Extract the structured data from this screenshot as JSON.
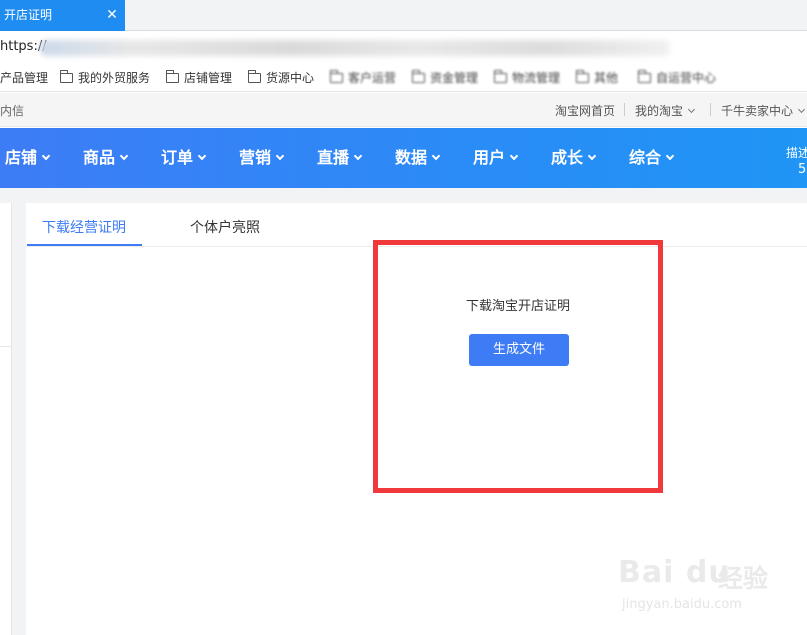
{
  "browser": {
    "tab_title": "开店证明",
    "close_glyph": "✕",
    "url_visible": "https://",
    "bookmarks": [
      "产品管理",
      "我的外贸服务",
      "店铺管理",
      "货源中心",
      "客户运营",
      "资金管理",
      "物流管理",
      "其他",
      "自运营中心"
    ]
  },
  "topbar": {
    "left_text": "内信",
    "links": [
      "淘宝网首页",
      "我的淘宝",
      "千牛卖家中心"
    ]
  },
  "nav": {
    "items": [
      "店铺",
      "商品",
      "订单",
      "营销",
      "直播",
      "数据",
      "用户",
      "成长",
      "综合"
    ],
    "right_top": "描述",
    "right_bottom": "5"
  },
  "content": {
    "tabs": [
      "下载经营证明",
      "个体户亮照"
    ],
    "active_tab": 0,
    "download_title": "下载淘宝开店证明",
    "generate_button": "生成文件"
  },
  "colors": {
    "nav_blue": "#3d7cf5",
    "tab_blue": "#1e8cf0",
    "highlight_red": "#f0393b"
  },
  "watermark": {
    "logo": "Bai du",
    "text": "经验",
    "url": "jingyan.baidu.com"
  }
}
